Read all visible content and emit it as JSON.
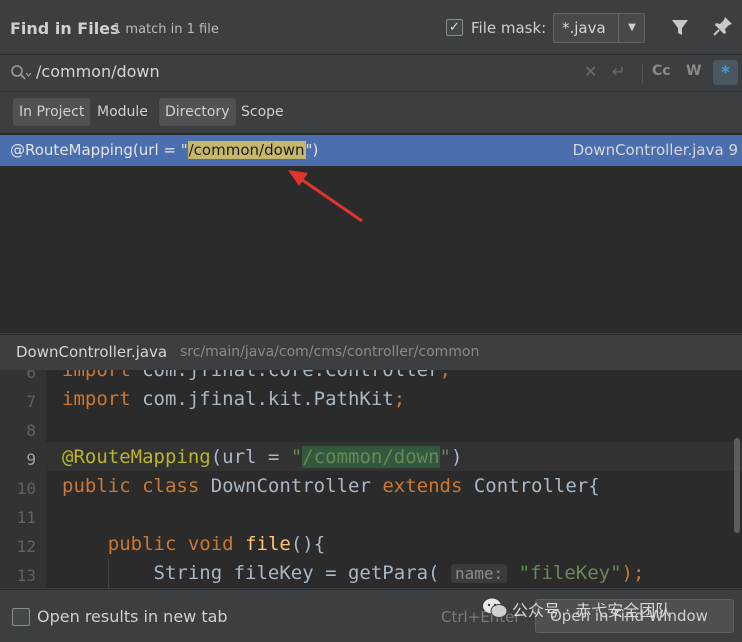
{
  "header": {
    "title": "Find in Files",
    "match_summary": "1 match in 1 file",
    "file_mask_label": "File mask:",
    "file_mask_checked": true,
    "file_mask_value": "*.java",
    "filter_icon": "filter-icon",
    "pin_icon": "pin-icon"
  },
  "search": {
    "query": "/common/down",
    "icons": [
      "search-icon",
      "clear-icon",
      "newline-icon"
    ],
    "match_case_label": "Cc",
    "words_label": "W",
    "regex_label": ".*",
    "regex_active": true
  },
  "scopes": [
    {
      "label": "In Project",
      "selected": true
    },
    {
      "label": "Module",
      "selected": false
    },
    {
      "label": "Directory",
      "selected": true
    },
    {
      "label": "Scope",
      "selected": false
    }
  ],
  "results": [
    {
      "prefix": "@RouteMapping(url = \"",
      "match": "/common/down",
      "suffix": "\")",
      "file": "DownController.java 9"
    }
  ],
  "preview": {
    "file_name": "DownController.java",
    "file_path": "src/main/java/com/cms/controller/common",
    "lines": [
      {
        "num": "6",
        "text": "import com.jfinal.core.Controller;"
      },
      {
        "num": "7",
        "text": "import com.jfinal.kit.PathKit;"
      },
      {
        "num": "8",
        "text": ""
      },
      {
        "num": "9",
        "text": "@RouteMapping(url = \"/common/down\")"
      },
      {
        "num": "10",
        "text": "public class DownController extends Controller{"
      },
      {
        "num": "11",
        "text": ""
      },
      {
        "num": "12",
        "text": "    public void file(){"
      },
      {
        "num": "13",
        "text": "        String fileKey = getPara( name: \"fileKey\");"
      }
    ],
    "parts": {
      "import_kw": "import",
      "line6_rest": " com.jfinal.core.Controller",
      "line7_rest": " com.jfinal.kit.PathKit",
      "semicolon": ";",
      "ann": "@RouteMapping",
      "url_part": "(url = ",
      "quote": "\"",
      "route": "/common/down",
      "close": ")",
      "public_kw": "public",
      "class_kw": "class",
      "class_name": " DownController ",
      "extends_kw": "extends",
      "parent": " Controller{",
      "void_kw": "void",
      "method": "file",
      "method_paren": "(){",
      "string_type": "String",
      "var_assign": " fileKey = getPara(",
      "hint": "name:",
      "arg": "\"fileKey\"",
      "end": ");"
    }
  },
  "footer": {
    "new_tab_label": "Open results in new tab",
    "new_tab_checked": false,
    "shortcut": "Ctrl+Enter",
    "open_button": "Open in Find Window"
  },
  "watermark": {
    "text": "公众号 · 赤弋安全团队",
    "icon": "wechat-logo-icon"
  },
  "colors": {
    "selection": "#4b6eaf",
    "match_highlight": "#c5b86a",
    "keyword": "#cc7832",
    "annotation": "#bbb529",
    "string": "#6a8759",
    "arrow": "#e0352b"
  }
}
